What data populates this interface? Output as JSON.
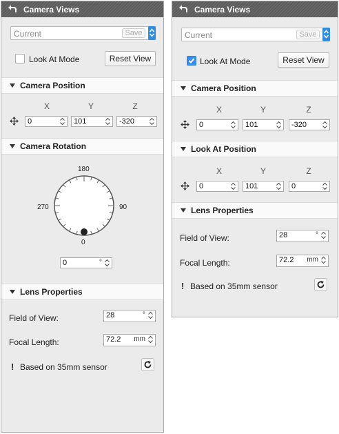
{
  "left_panel": {
    "title": "Camera Views",
    "preset": {
      "value": "Current",
      "save_label": "Save"
    },
    "look_at_mode": {
      "label": "Look At Mode",
      "checked": false
    },
    "reset_label": "Reset View",
    "camera_position": {
      "header": "Camera Position",
      "axes": {
        "x": "X",
        "y": "Y",
        "z": "Z"
      },
      "values": {
        "x": "0",
        "y": "101",
        "z": "-320"
      }
    },
    "camera_rotation": {
      "header": "Camera Rotation",
      "dial_labels": {
        "top": "180",
        "right": "90",
        "bottom": "0",
        "left": "270"
      },
      "angle_value": "0",
      "angle_unit": "°"
    },
    "lens": {
      "header": "Lens Properties",
      "fov_label": "Field of View:",
      "fov_value": "28",
      "fov_unit": "°",
      "focal_label": "Focal Length:",
      "focal_value": "72.2",
      "focal_unit": "mm",
      "note": "Based on 35mm sensor",
      "note_icon": "!"
    }
  },
  "right_panel": {
    "title": "Camera Views",
    "preset": {
      "value": "Current",
      "save_label": "Save"
    },
    "look_at_mode": {
      "label": "Look At Mode",
      "checked": true
    },
    "reset_label": "Reset View",
    "camera_position": {
      "header": "Camera Position",
      "axes": {
        "x": "X",
        "y": "Y",
        "z": "Z"
      },
      "values": {
        "x": "0",
        "y": "101",
        "z": "-320"
      }
    },
    "look_at_position": {
      "header": "Look At Position",
      "axes": {
        "x": "X",
        "y": "Y",
        "z": "Z"
      },
      "values": {
        "x": "0",
        "y": "101",
        "z": "0"
      }
    },
    "lens": {
      "header": "Lens Properties",
      "fov_label": "Field of View:",
      "fov_value": "28",
      "fov_unit": "°",
      "focal_label": "Focal Length:",
      "focal_value": "72.2",
      "focal_unit": "mm",
      "note": "Based on 35mm sensor",
      "note_icon": "!"
    }
  },
  "icons": {
    "back": "back-arrow-icon",
    "move": "move-arrows-icon",
    "collapse": "triangle-down-icon",
    "refresh": "refresh-icon",
    "spinner": "spinner-icon",
    "check": "checkmark-icon"
  },
  "colors": {
    "titlebar": "#666666",
    "panel_bg": "#ebebeb",
    "accent_blue": "#2e8de0"
  }
}
